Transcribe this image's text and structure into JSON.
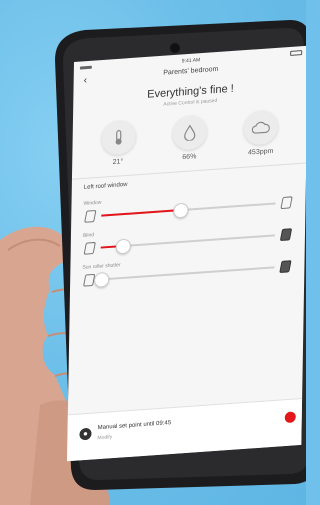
{
  "status_bar": {
    "time": "9:41 AM"
  },
  "header": {
    "title": "Parents' bedroom",
    "back_glyph": "‹"
  },
  "status": {
    "title": "Everything's fine !",
    "subtitle": "Active Control is paused"
  },
  "metrics": [
    {
      "icon": "thermometer-icon",
      "value": "21°"
    },
    {
      "icon": "humidity-drop-icon",
      "value": "66%"
    },
    {
      "icon": "co2-cloud-icon",
      "value": "453ppm"
    }
  ],
  "section_title": "Left roof window",
  "sliders": [
    {
      "label": "Window",
      "level_percent": 45,
      "left_icon": "window-closed-icon",
      "right_icon": "window-open-icon"
    },
    {
      "label": "Blind",
      "level_percent": 12,
      "left_icon": "blind-open-icon",
      "right_icon": "blind-closed-icon"
    },
    {
      "label": "Sun roller shutter",
      "level_percent": 0,
      "left_icon": "shutter-open-icon",
      "right_icon": "shutter-closed-icon"
    }
  ],
  "bottom_bar": {
    "title": "Manual set point until 09:45",
    "subtitle": "Modify"
  },
  "colors": {
    "accent": "#e2161b",
    "background": "#6fc0ea"
  }
}
